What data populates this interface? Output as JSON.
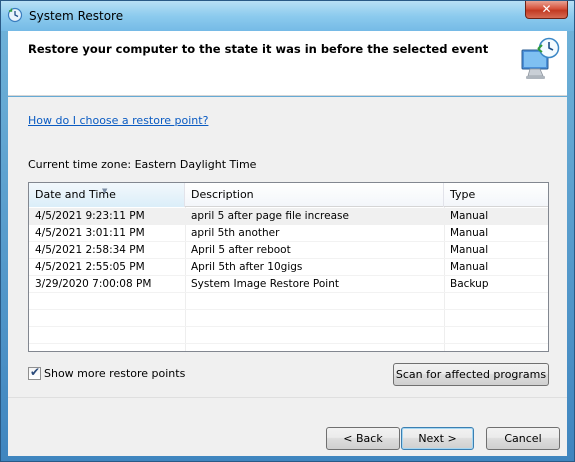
{
  "window": {
    "title": "System Restore",
    "close_label": "✕"
  },
  "header": {
    "title": "Restore your computer to the state it was in before the selected event",
    "icon": "system-restore-monitor-icon"
  },
  "content": {
    "help_link": "How do I choose a restore point?",
    "timezone": "Current time zone: Eastern Daylight Time"
  },
  "table": {
    "columns": [
      "Date and Time",
      "Description",
      "Type"
    ],
    "sorted_column": "Date and Time",
    "rows": [
      {
        "date": "4/5/2021 9:23:11 PM",
        "description": "april 5 after page file increase",
        "type": "Manual",
        "selected": true
      },
      {
        "date": "4/5/2021 3:01:11 PM",
        "description": "april 5th another",
        "type": "Manual",
        "selected": false
      },
      {
        "date": "4/5/2021 2:58:34 PM",
        "description": "April 5 after reboot",
        "type": "Manual",
        "selected": false
      },
      {
        "date": "4/5/2021 2:55:05 PM",
        "description": "April 5th after 10gigs",
        "type": "Manual",
        "selected": false
      },
      {
        "date": "3/29/2020 7:00:08 PM",
        "description": "System Image Restore Point",
        "type": "Backup",
        "selected": false
      }
    ]
  },
  "options": {
    "show_more_label": "Show more restore points",
    "show_more_checked": true,
    "scan_button": "Scan for affected programs"
  },
  "footer": {
    "back_button": "< Back",
    "next_button": "Next >",
    "cancel_button": "Cancel"
  },
  "colors": {
    "link": "#0a5bc2",
    "titlebar": "#8ccbee",
    "close_button": "#d6533d"
  }
}
